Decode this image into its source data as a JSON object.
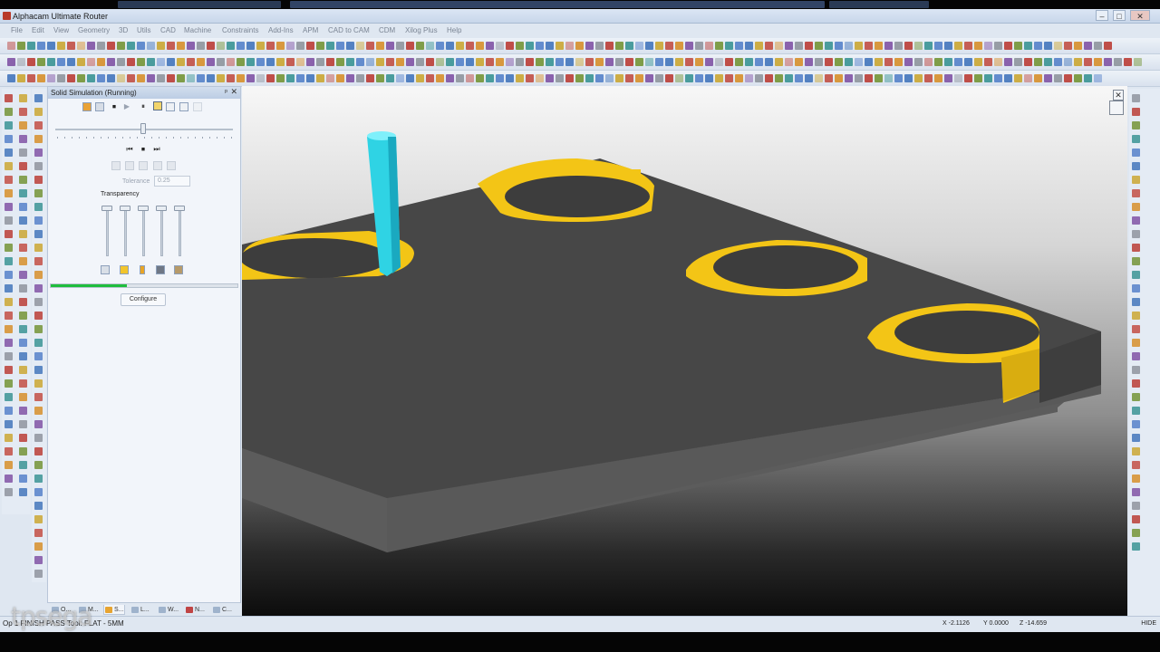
{
  "app": {
    "title": "Alphacam Ultimate Router",
    "win_min": "–",
    "win_max": "□",
    "win_close": "✕"
  },
  "menu": [
    "File",
    "Edit",
    "View",
    "Geometry",
    "3D",
    "Utils",
    "CAD",
    "Machine",
    "Constraints",
    "Add-Ins",
    "APM",
    "CAD to CAM",
    "CDM",
    "Xilog Plus",
    "Help"
  ],
  "sim_panel": {
    "title": "Solid Simulation (Running)",
    "pin": "ᵖ",
    "close": "✕",
    "tolerance_label": "Tolerance",
    "tolerance_value": "0.25",
    "transparency_label": "Transparency",
    "progress": 0.41,
    "configure_label": "Configure",
    "play_controls": [
      "⏹",
      "▶",
      "⏸"
    ],
    "step_controls": [
      "⏮",
      "⏹",
      "⏭"
    ]
  },
  "bottom_tabs": [
    "O...",
    "M...",
    "S...",
    "L...",
    "W...",
    "N...",
    "C..."
  ],
  "viewport": {
    "close": "✕"
  },
  "status": {
    "left": "Op 1  FINISH PASS  Tool: FLAT - 5MM",
    "x": "X -2.1126",
    "y": "Y 0.0000",
    "z": "Z -14.659",
    "right": "HIDE"
  },
  "watermark": "tpsega",
  "colors": {
    "part": "#4a4a4a",
    "cut": "#f3c516",
    "tool": "#33d6e6",
    "progress": "#1fbd3d"
  }
}
